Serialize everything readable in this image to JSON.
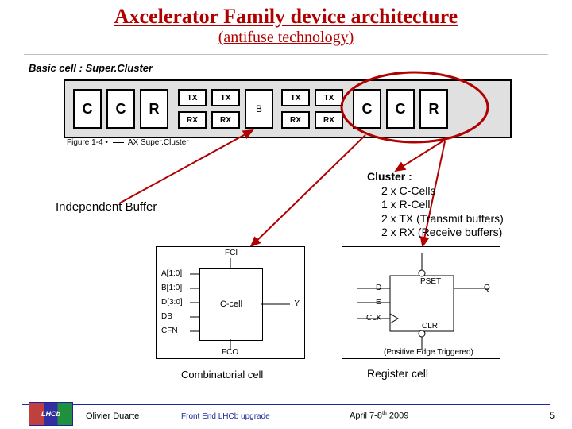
{
  "title": "Axcelerator Family device architecture",
  "subtitle": "(antifuse technology)",
  "basic_cell_label": "Basic cell : Super.Cluster",
  "supercluster": {
    "cells": [
      "C",
      "C",
      "R",
      "C",
      "C",
      "R"
    ],
    "buffers": [
      [
        "TX",
        "TX"
      ],
      [
        "RX",
        "RX"
      ],
      [
        "TX",
        "TX"
      ],
      [
        "RX",
        "RX"
      ]
    ],
    "figure_caption_prefix": "Figure 1-4 •",
    "figure_caption": "AX Super.Cluster"
  },
  "independent_buffer_label": "Independent Buffer",
  "cluster": {
    "header": "Cluster :",
    "lines": [
      "2 x C-Cells",
      "1 x R-Cell",
      "2 x TX (Transmit buffers)",
      "2 x RX (Receive buffers)"
    ]
  },
  "ccell": {
    "block_label": "C-cell",
    "ports_left": [
      "A[1:0]",
      "B[1:0]",
      "D[3:0]",
      "DB",
      "CFN"
    ],
    "port_top": "FCI",
    "port_bottom": "FCO",
    "port_right": "Y"
  },
  "rcell": {
    "inputs": [
      "D",
      "E",
      "CLK"
    ],
    "set": "PSET",
    "clr": "CLR",
    "out": "Q",
    "note": "(Positive Edge Triggered)"
  },
  "comb_label": "Combinatorial cell",
  "reg_label": "Register cell",
  "footer": {
    "author": "Olivier Duarte",
    "center": "Front End LHCb upgrade",
    "date_prefix": "April 7-8",
    "date_sup": "th",
    "date_year": " 2009",
    "page": "5",
    "logo": "LHCb"
  }
}
